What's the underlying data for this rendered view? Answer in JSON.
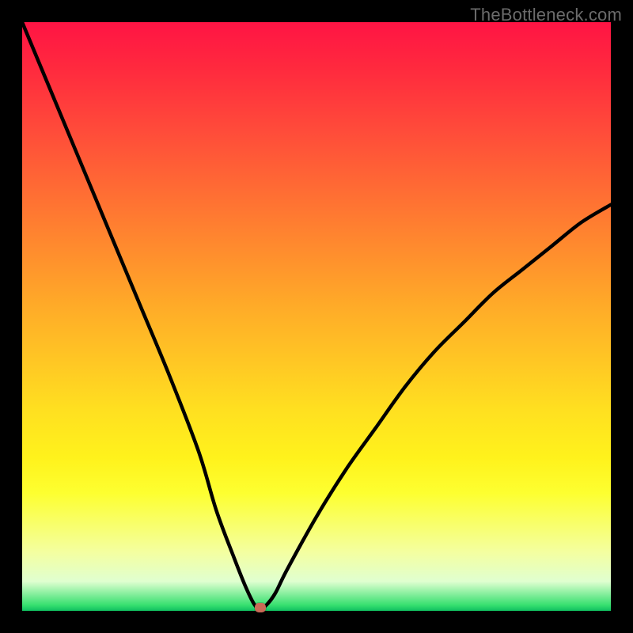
{
  "source_watermark": "TheBottleneck.com",
  "chart_data": {
    "type": "line",
    "title": "",
    "xlabel": "",
    "ylabel": "",
    "xlim": [
      0,
      100
    ],
    "ylim": [
      0,
      100
    ],
    "grid": false,
    "legend": false,
    "background": {
      "kind": "vertical_gradient_red_to_green",
      "top_color": "#ff1444",
      "bottom_color": "#10c060"
    },
    "series": [
      {
        "name": "bottleneck-curve",
        "color": "#000000",
        "x": [
          0,
          5,
          10,
          15,
          20,
          25,
          30,
          33,
          36,
          38,
          39.5,
          40.5,
          41.5,
          43,
          45,
          50,
          55,
          60,
          65,
          70,
          75,
          80,
          85,
          90,
          95,
          100
        ],
        "y": [
          100,
          88,
          76,
          64,
          52,
          40,
          27,
          17,
          9,
          4,
          1,
          0.5,
          1,
          3,
          7,
          16,
          24,
          31,
          38,
          44,
          49,
          54,
          58,
          62,
          66,
          69
        ]
      }
    ],
    "annotations": [
      {
        "name": "minimum-marker",
        "x": 40.5,
        "y": 0.5,
        "color": "#c96a56"
      }
    ]
  }
}
